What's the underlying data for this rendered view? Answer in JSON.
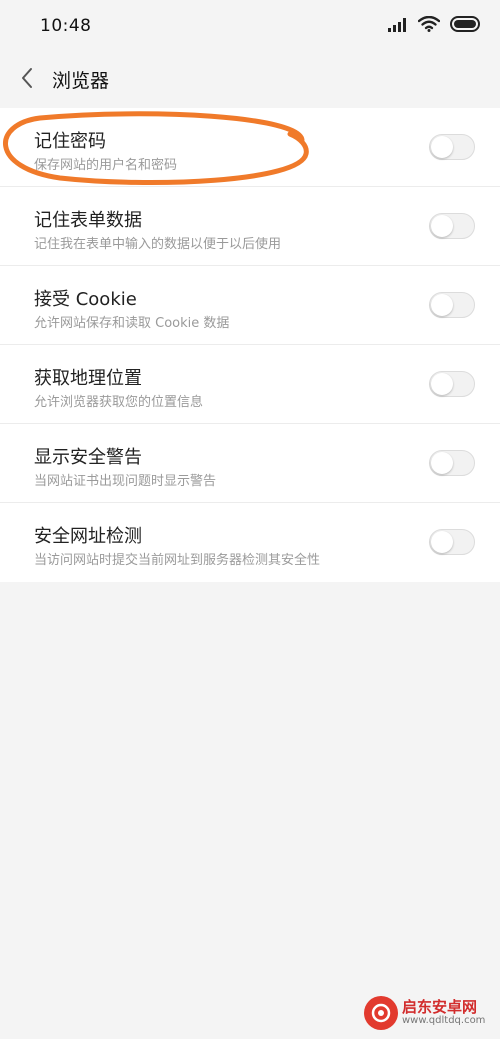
{
  "status_bar": {
    "time": "10:48",
    "icons": [
      "signal-icon",
      "wifi-icon",
      "battery-icon"
    ]
  },
  "nav": {
    "back_icon": "chevron-left-icon",
    "title": "浏览器"
  },
  "settings": [
    {
      "title": "记住密码",
      "subtitle": "保存网站的用户名和密码",
      "enabled": false
    },
    {
      "title": "记住表单数据",
      "subtitle": "记住我在表单中输入的数据以便于以后使用",
      "enabled": false
    },
    {
      "title": "接受 Cookie",
      "subtitle": "允许网站保存和读取 Cookie 数据",
      "enabled": false
    },
    {
      "title": "获取地理位置",
      "subtitle": "允许浏览器获取您的位置信息",
      "enabled": false
    },
    {
      "title": "显示安全警告",
      "subtitle": "当网站证书出现问题时显示警告",
      "enabled": false
    },
    {
      "title": "安全网址检测",
      "subtitle": "当访问网站时提交当前网址到服务器检测其安全性",
      "enabled": false
    }
  ],
  "annotation_color": "#f07a2a",
  "watermark": {
    "name": "启东安卓网",
    "url": "www.qdltdq.com"
  }
}
